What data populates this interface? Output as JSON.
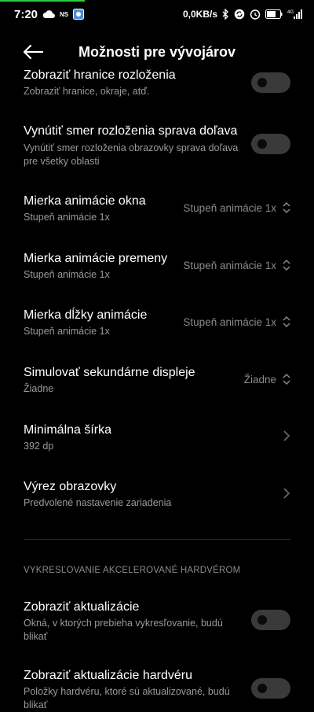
{
  "statusbar": {
    "time": "7:20",
    "ns": "NS",
    "speed": "0,0KB/s",
    "battery": "59",
    "signal_label": "4G"
  },
  "appbar": {
    "title": "Možnosti pre vývojárov"
  },
  "items": [
    {
      "title": "Zobraziť hranice rozloženia",
      "subtitle": "Zobraziť hranice, okraje, atď.",
      "toggle": false
    },
    {
      "title": "Vynútiť smer rozloženia sprava doľava",
      "subtitle": "Vynútiť smer rozloženia obrazovky sprava doľava pre všetky oblasti",
      "toggle": false
    },
    {
      "title": "Mierka animácie okna",
      "subtitle": "Stupeň animácie 1x",
      "value": "Stupeň animácie 1x"
    },
    {
      "title": "Mierka animácie premeny",
      "subtitle": "Stupeň animácie 1x",
      "value": "Stupeň animácie 1x"
    },
    {
      "title": "Mierka dĺžky animácie",
      "subtitle": "Stupeň animácie 1x",
      "value": "Stupeň animácie 1x"
    },
    {
      "title": "Simulovať sekundárne displeje",
      "subtitle": "Žiadne",
      "value": "Žiadne"
    },
    {
      "title": "Minimálna šírka",
      "subtitle": "392 dp"
    },
    {
      "title": "Výrez obrazovky",
      "subtitle": "Predvolené nastavenie zariadenia"
    }
  ],
  "section_header": "VYKRESĽOVANIE AKCELEROVANÉ HARDVÉROM",
  "hw_items": [
    {
      "title": "Zobraziť aktualizácie",
      "subtitle": "Okná, v ktorých prebieha vykresľovanie, budú blikať",
      "toggle": false
    },
    {
      "title": "Zobraziť aktualizácie hardvéru",
      "subtitle": "Položky hardvéru, ktoré sú aktualizované, budú blikať",
      "toggle": false
    }
  ]
}
